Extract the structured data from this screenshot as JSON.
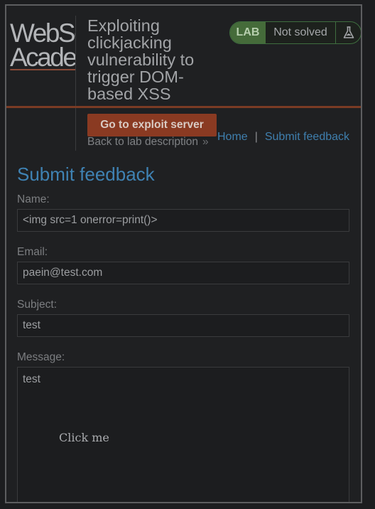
{
  "header": {
    "logo_line1": "WebSecurity",
    "logo_line2": "Academy",
    "title": "Exploiting clickjacking vulnerability to trigger DOM-based XSS",
    "badge": {
      "lab": "LAB",
      "status": "Not solved",
      "icon": "flask-icon"
    },
    "exploit_button": "Go to exploit server",
    "back_link": "Back to lab description",
    "back_chevron": "»"
  },
  "nav": {
    "home": "Home",
    "separator": "|",
    "feedback": "Submit feedback"
  },
  "form": {
    "title": "Submit feedback",
    "name_label": "Name:",
    "name_value": "<img src=1 onerror=print()>",
    "email_label": "Email:",
    "email_value": "paein@test.com",
    "subject_label": "Subject:",
    "subject_value": "test",
    "message_label": "Message:",
    "message_value": "test"
  },
  "overlay": {
    "click_me": "Click me"
  },
  "colors": {
    "background": "#1f2022",
    "accent_orange": "#8a3a22",
    "link_blue": "#3f7fae",
    "lab_green": "#456b3a"
  }
}
